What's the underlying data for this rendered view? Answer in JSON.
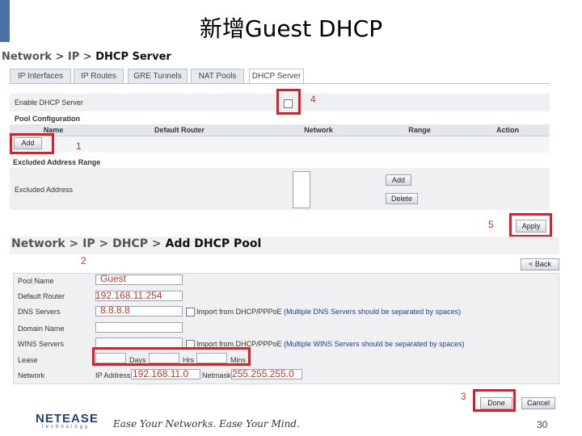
{
  "slide": {
    "title": "新增Guest DHCP",
    "page_number": "30"
  },
  "top": {
    "breadcrumb": {
      "a": "Network",
      "b": "IP",
      "c": "DHCP Server",
      "sep": ">"
    },
    "tabs": [
      "IP Interfaces",
      "IP Routes",
      "GRE Tunnels",
      "NAT Pools",
      "DHCP Server"
    ],
    "active_tab": "DHCP Server",
    "enable_label": "Enable DHCP Server",
    "pool_config_label": "Pool Configuration",
    "columns": [
      "Name",
      "Default Router",
      "Network",
      "Range",
      "Action"
    ],
    "add_button": "Add",
    "excluded_header": "Excluded Address Range",
    "excluded_label": "Excluded Address",
    "excl_add": "Add",
    "excl_delete": "Delete",
    "apply_button": "Apply"
  },
  "bottom": {
    "breadcrumb": {
      "a": "Network",
      "b": "IP",
      "c": "DHCP",
      "d": "Add DHCP Pool",
      "sep": ">"
    },
    "back_button": "< Back",
    "fields": {
      "pool_name": {
        "label": "Pool Name",
        "value": "Guest"
      },
      "default_router": {
        "label": "Default Router",
        "value": "192.168.11.254"
      },
      "dns": {
        "label": "DNS Servers",
        "value": "8.8.8.8",
        "hint_a": "Import from DHCP/PPPoE",
        "hint_b": "(Multiple DNS Servers should be separated by spaces)"
      },
      "domain": {
        "label": "Domain Name",
        "value": ""
      },
      "wins": {
        "label": "WINS Servers",
        "value": "",
        "hint_a": "Import from DHCP/PPPoE",
        "hint_b": "(Multiple WINS Servers should be separated by spaces)"
      },
      "lease": {
        "label": "Lease",
        "days": "Days",
        "hrs": "Hrs",
        "mins": "Mins"
      },
      "network": {
        "label": "Network",
        "ip_label": "IP Address",
        "ip_value": "192.168.11.0",
        "mask_label": "Netmask",
        "mask_value": "255.255.255.0"
      }
    },
    "done_button": "Done",
    "cancel_button": "Cancel"
  },
  "callouts": [
    "1",
    "2",
    "3",
    "4",
    "5"
  ],
  "footer": {
    "logo": "NETEASE",
    "logo_sub": "technology",
    "slogan": "Ease Your Networks. Ease Your Mind."
  },
  "colors": {
    "highlight": "#e01c24",
    "callout": "#c0392b",
    "accent": "#4a6fa5"
  }
}
